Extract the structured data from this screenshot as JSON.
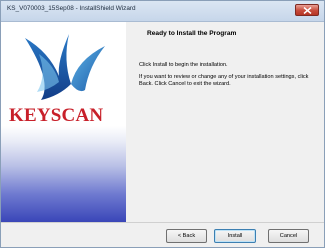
{
  "window": {
    "title": "KS_V070003_15Sep08 - InstallShield Wizard"
  },
  "banner": {
    "brand": "KEYSCAN",
    "brand_color": "#c8202a",
    "logo_icon": "keyscan-k-logo-icon"
  },
  "page": {
    "heading": "Ready to Install the Program",
    "paragraph1": "Click Install to begin the installation.",
    "paragraph2": "If you want to review or change any of your installation settings, click Back. Click Cancel to exit the wizard."
  },
  "buttons": {
    "back": "< Back",
    "install": "Install",
    "cancel": "Cancel"
  },
  "colors": {
    "close_button": "#c74a3a",
    "banner_gradient_bottom": "#3a46b8"
  }
}
